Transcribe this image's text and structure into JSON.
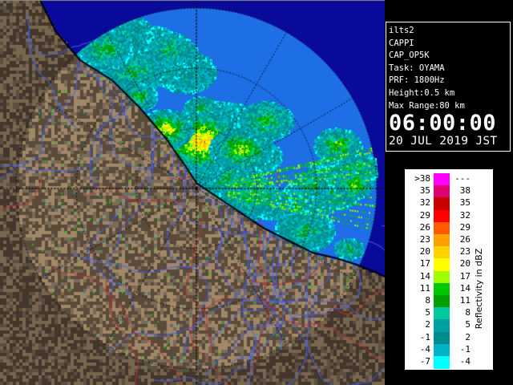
{
  "radar": {
    "site": "ilts2",
    "product": "CAPPI",
    "scan_mode": "CAP_OP5K",
    "task": "Task: OYAMA",
    "prf": "PRF: 1800Hz",
    "height": "Height:0.5 km",
    "max_range": "Max Range:80 km",
    "time": "06:00:00",
    "date": "20 JUL 2019 JST"
  },
  "legend": {
    "title": "Reflectivity in dBZ",
    "bins": [
      {
        "min": ">38",
        "max": "---",
        "color": "#ff00ff"
      },
      {
        "min": "35",
        "max": "38",
        "color": "#e0006e"
      },
      {
        "min": "32",
        "max": "35",
        "color": "#c80000"
      },
      {
        "min": "29",
        "max": "32",
        "color": "#ff0000"
      },
      {
        "min": "26",
        "max": "29",
        "color": "#ff5a00"
      },
      {
        "min": "23",
        "max": "26",
        "color": "#ffa000"
      },
      {
        "min": "20",
        "max": "23",
        "color": "#ffd200"
      },
      {
        "min": "17",
        "max": "20",
        "color": "#ffff00"
      },
      {
        "min": "14",
        "max": "17",
        "color": "#a0ff00"
      },
      {
        "min": "11",
        "max": "14",
        "color": "#00c800"
      },
      {
        "min": "8",
        "max": "11",
        "color": "#00a000"
      },
      {
        "min": "5",
        "max": "8",
        "color": "#00c8a0"
      },
      {
        "min": "2",
        "max": "5",
        "color": "#00a0a0"
      },
      {
        "min": "-1",
        "max": "2",
        "color": "#008c8c"
      },
      {
        "min": "-4",
        "max": "-1",
        "color": "#00b4c8"
      },
      {
        "min": "-7",
        "max": "-4",
        "color": "#00ffff"
      }
    ]
  },
  "colors": {
    "sea": "#0a0a9a",
    "radar_coverage": "#1e6ee6",
    "land_dark": "#5a4a3a",
    "land_light": "#a08868",
    "rivers": "#4060ff",
    "borders": "#c03030"
  }
}
